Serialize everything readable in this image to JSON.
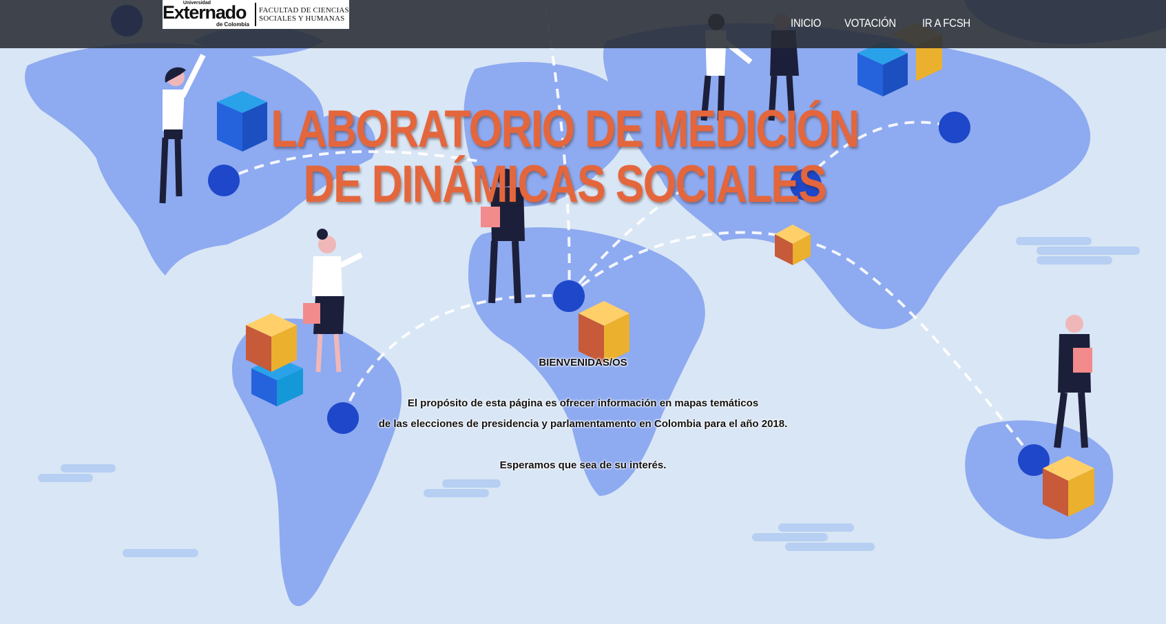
{
  "header": {
    "logo": {
      "university_small": "Universidad",
      "university_name": "Externado",
      "university_sub": "de Colombia",
      "faculty_line1": "FACULTAD DE CIENCIAS",
      "faculty_line2": "SOCIALES Y HUMANAS"
    },
    "nav": [
      {
        "label": "INICIO"
      },
      {
        "label": "VOTACIÓN"
      },
      {
        "label": "IR A FCSH"
      }
    ]
  },
  "hero": {
    "title_line1": "LABORATORIO DE MEDICIÓN",
    "title_line2": "DE DINÁMICAS SOCIALES"
  },
  "welcome": {
    "heading": "BIENVENIDAS/OS",
    "line1": "El propósito de esta página es ofrecer información en mapas temáticos",
    "line2": "de las elecciones de presidencia y parlamentamento en Colombia para el año 2018.",
    "line3": "Esperamos que sea de su interés."
  },
  "colors": {
    "background": "#d9e6f5",
    "continents": "#8eaaf0",
    "title": "#e4663c",
    "header_bar": "#2c3038"
  }
}
